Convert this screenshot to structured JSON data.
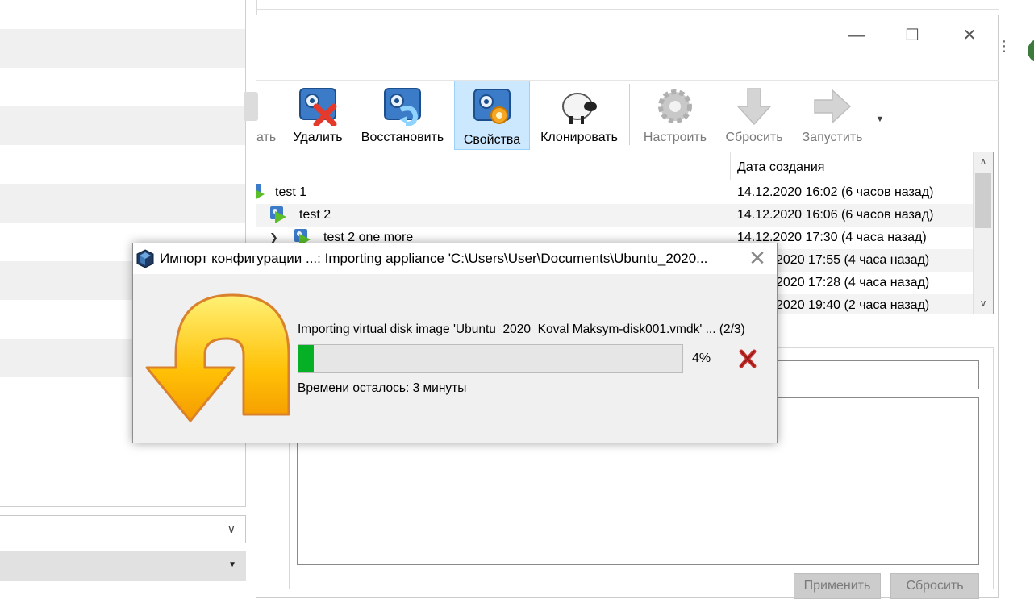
{
  "toolbar": {
    "items": [
      {
        "label": "ать",
        "icon": "take-snapshot-icon",
        "disabled": true
      },
      {
        "label": "Удалить",
        "icon": "delete-snapshot-icon"
      },
      {
        "label": "Восстановить",
        "icon": "restore-snapshot-icon"
      },
      {
        "label": "Свойства",
        "icon": "snapshot-properties-icon",
        "active": true
      },
      {
        "label": "Клонировать",
        "icon": "clone-sheep-icon"
      },
      {
        "label": "Настроить",
        "icon": "settings-gear-icon",
        "disabled": true
      },
      {
        "label": "Сбросить",
        "icon": "discard-arrow-icon",
        "disabled": true
      },
      {
        "label": "Запустить",
        "icon": "start-arrow-icon",
        "disabled": true
      }
    ],
    "more_icon": "dropdown-triangle-icon"
  },
  "snapshots": {
    "header_date": "Дата создания",
    "rows": [
      {
        "name": "test 1",
        "date": "14.12.2020 16:02 (6 часов назад)"
      },
      {
        "name": "test 2",
        "date": "14.12.2020 16:06 (6 часов назад)"
      },
      {
        "name": "test 2 one more",
        "date": "14.12.2020 17:30 (4 часа назад)"
      },
      {
        "name": "",
        "date": "2020 17:55 (4 часа назад)"
      },
      {
        "name": "",
        "date": "2020 17:28 (4 часа назад)"
      },
      {
        "name": "",
        "date": "2020 19:40 (2 часа назад)"
      }
    ]
  },
  "details": {
    "apply_label": "Применить",
    "reset_label": "Сбросить"
  },
  "dialog": {
    "title": "Импорт конфигурации ...: Importing appliance 'C:\\Users\\User\\Documents\\Ubuntu_2020...",
    "status": "Importing virtual disk image 'Ubuntu_2020_Koval Maksym-disk001.vmdk' ... (2/3)",
    "progress_percent": 4,
    "percent_label": "4%",
    "time_left": "Времени осталось: 3 минуты"
  },
  "colors": {
    "progress_fill": "#06b025",
    "toolbar_active_bg": "#cce8ff",
    "window_bg": "#ffffff",
    "dialog_bg": "#f0f0f0"
  }
}
